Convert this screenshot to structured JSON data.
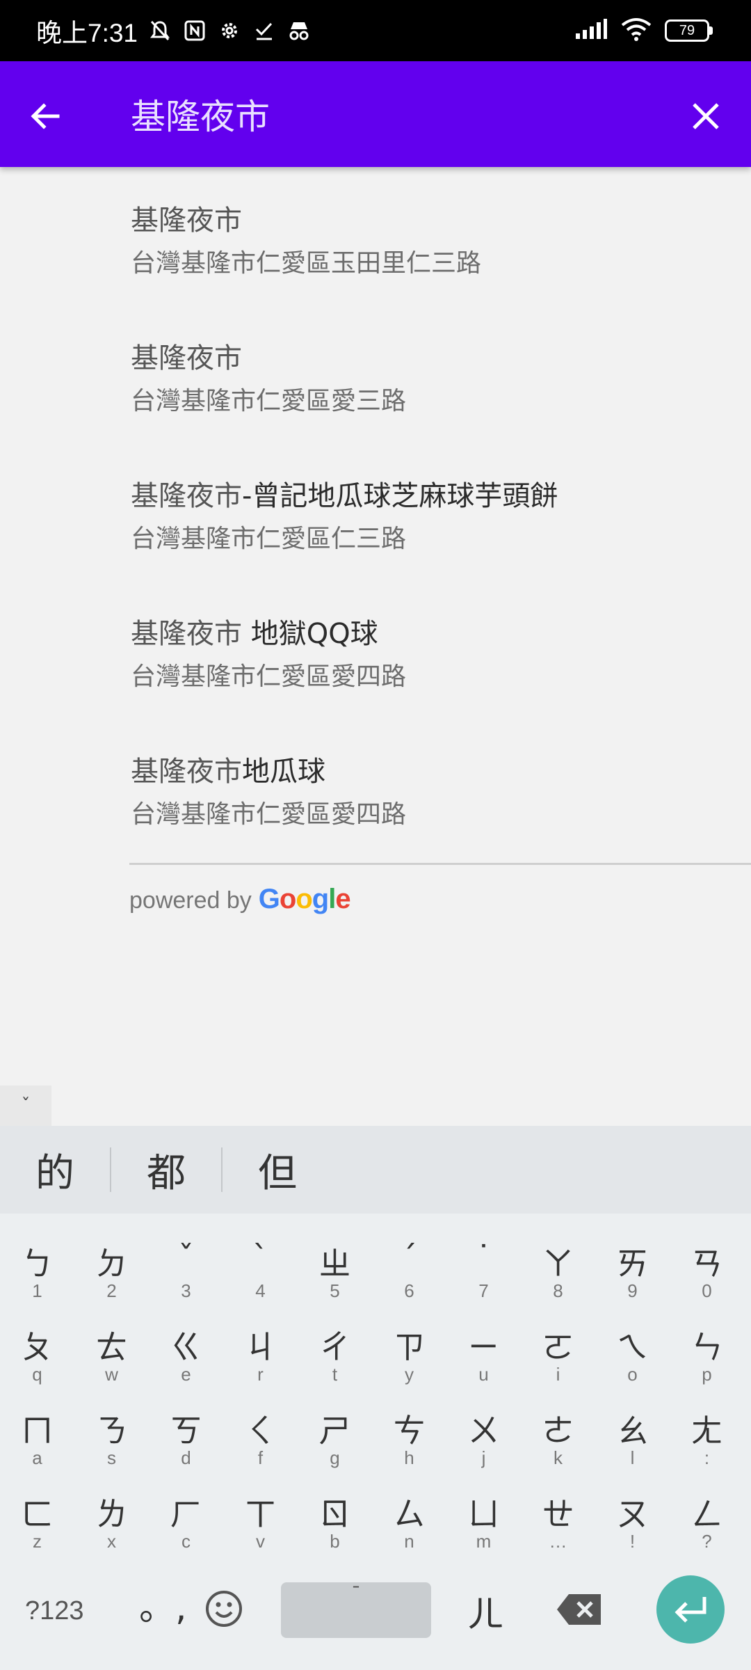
{
  "status_bar": {
    "time": "晚上7:31",
    "battery": "79",
    "icons": [
      "mute-icon",
      "nfc-icon",
      "settings-icon",
      "check-icon",
      "incognito-icon",
      "signal-icon",
      "wifi-icon",
      "battery-icon"
    ]
  },
  "search": {
    "query": "基隆夜市",
    "back_icon": "arrow-back-icon",
    "clear_icon": "close-icon",
    "bar_color": "#6200ee"
  },
  "results": [
    {
      "prefix": "基隆夜市",
      "suffix": "",
      "address": "台灣基隆市仁愛區玉田里仁三路"
    },
    {
      "prefix": "基隆夜市",
      "suffix": "",
      "address": "台灣基隆市仁愛區愛三路"
    },
    {
      "prefix": "基隆夜市",
      "suffix": "-曾記地瓜球芝麻球芋頭餅",
      "address": "台灣基隆市仁愛區仁三路"
    },
    {
      "prefix": "基隆夜市",
      "suffix": " 地獄QQ球",
      "address": "台灣基隆市仁愛區愛四路"
    },
    {
      "prefix": "基隆夜市",
      "suffix": "地瓜球",
      "address": "台灣基隆市仁愛區愛四路"
    }
  ],
  "attribution": {
    "powered_by": "powered by",
    "brand": "Google"
  },
  "keyboard": {
    "collapse": "ˇ",
    "candidates": [
      "的",
      "都",
      "但"
    ],
    "rows": [
      [
        {
          "m": "ㄅ",
          "h": "1"
        },
        {
          "m": "ㄉ",
          "h": "2"
        },
        {
          "m": "ˇ",
          "h": "3"
        },
        {
          "m": "ˋ",
          "h": "4"
        },
        {
          "m": "ㄓ",
          "h": "5"
        },
        {
          "m": "ˊ",
          "h": "6"
        },
        {
          "m": "˙",
          "h": "7"
        },
        {
          "m": "ㄚ",
          "h": "8"
        },
        {
          "m": "ㄞ",
          "h": "9"
        },
        {
          "m": "ㄢ",
          "h": "0"
        }
      ],
      [
        {
          "m": "ㄆ",
          "h": "q"
        },
        {
          "m": "ㄊ",
          "h": "w"
        },
        {
          "m": "ㄍ",
          "h": "e"
        },
        {
          "m": "ㄐ",
          "h": "r"
        },
        {
          "m": "ㄔ",
          "h": "t"
        },
        {
          "m": "ㄗ",
          "h": "y"
        },
        {
          "m": "ㄧ",
          "h": "u"
        },
        {
          "m": "ㄛ",
          "h": "i"
        },
        {
          "m": "ㄟ",
          "h": "o"
        },
        {
          "m": "ㄣ",
          "h": "p"
        }
      ],
      [
        {
          "m": "ㄇ",
          "h": "a"
        },
        {
          "m": "ㄋ",
          "h": "s"
        },
        {
          "m": "ㄎ",
          "h": "d"
        },
        {
          "m": "ㄑ",
          "h": "f"
        },
        {
          "m": "ㄕ",
          "h": "g"
        },
        {
          "m": "ㄘ",
          "h": "h"
        },
        {
          "m": "ㄨ",
          "h": "j"
        },
        {
          "m": "ㄜ",
          "h": "k"
        },
        {
          "m": "ㄠ",
          "h": "l"
        },
        {
          "m": "ㄤ",
          "h": ":"
        }
      ],
      [
        {
          "m": "ㄈ",
          "h": "z"
        },
        {
          "m": "ㄌ",
          "h": "x"
        },
        {
          "m": "ㄏ",
          "h": "c"
        },
        {
          "m": "ㄒ",
          "h": "v"
        },
        {
          "m": "ㄖ",
          "h": "b"
        },
        {
          "m": "ㄙ",
          "h": "n"
        },
        {
          "m": "ㄩ",
          "h": "m"
        },
        {
          "m": "ㄝ",
          "h": "…"
        },
        {
          "m": "ㄡ",
          "h": "!"
        },
        {
          "m": "ㄥ",
          "h": "?"
        }
      ]
    ],
    "symbols_label": "?123",
    "punct_label": "。,",
    "space_label": "ˉ",
    "er_label": "ㄦ",
    "enter_color": "#4db6ac"
  }
}
